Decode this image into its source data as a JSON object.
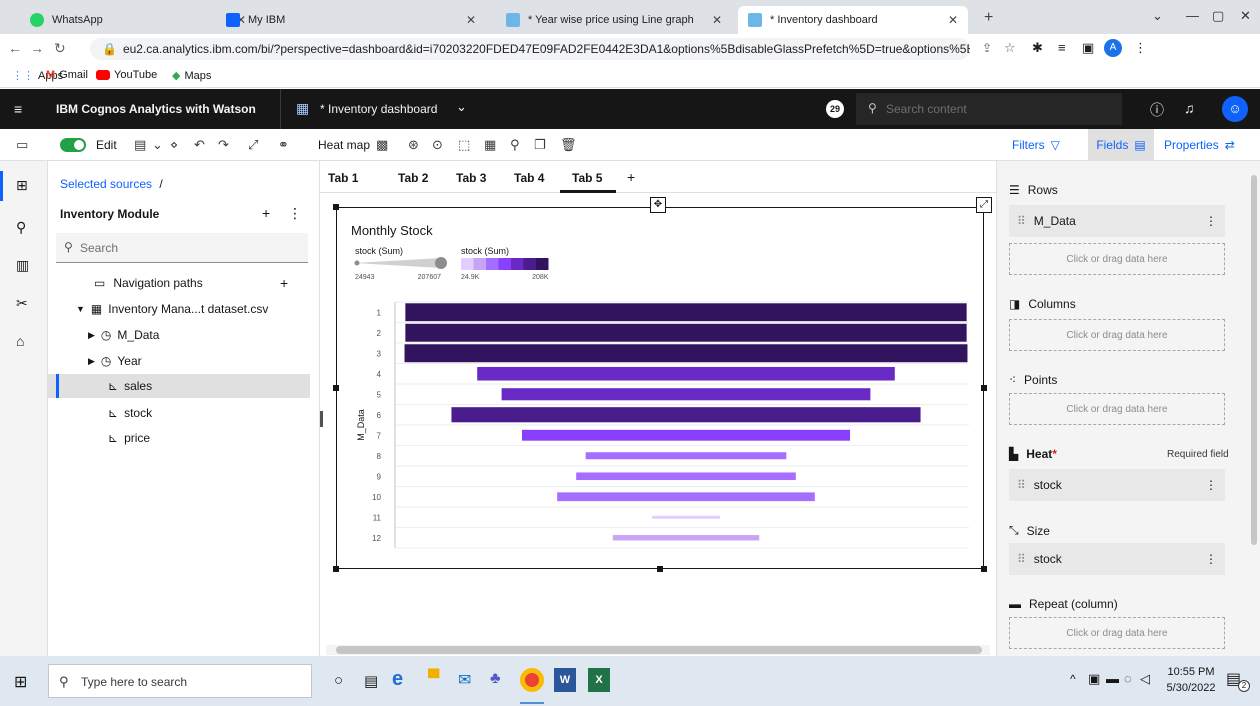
{
  "browser": {
    "tabs": [
      {
        "title": "WhatsApp",
        "favicon_color": "#25d366"
      },
      {
        "title": "My IBM",
        "favicon_color": "#0f62fe"
      },
      {
        "title": "* Year wise price using Line graph",
        "favicon_color": "#6cb6e8"
      },
      {
        "title": "* Inventory dashboard",
        "favicon_color": "#6cb6e8"
      }
    ],
    "new_tab": "+",
    "url": "eu2.ca.analytics.ibm.com/bi/?perspective=dashboard&id=i70203220FDED47E09FAD2FE0442E3DA1&options%5BdisableGlassPrefetch%5D=true&options%5Bcollections%5D%5BcanvasE...",
    "profile_initial": "A",
    "bookmarks": [
      {
        "label": "Apps",
        "color": "#4285f4"
      },
      {
        "label": "Gmail",
        "color": "#ea4335"
      },
      {
        "label": "YouTube",
        "color": "#ff0000"
      },
      {
        "label": "Maps",
        "color": "#34a853"
      }
    ]
  },
  "app": {
    "product": "IBM Cognos Analytics with Watson",
    "dashboard_title": "* Inventory dashboard",
    "notification_count": "29",
    "search_placeholder": "Search content"
  },
  "toolbar": {
    "edit_label": "Edit",
    "viz_type": "Heat map",
    "filters_label": "Filters",
    "fields_label": "Fields",
    "properties_label": "Properties"
  },
  "sources": {
    "breadcrumb": "Selected sources",
    "breadcrumb_sep": "/",
    "module": "Inventory Module",
    "search_placeholder": "Search",
    "items": [
      {
        "label": "Navigation paths",
        "icon": "folder-icon"
      },
      {
        "label": "Inventory Mana...t dataset.csv",
        "icon": "table-icon"
      },
      {
        "label": "M_Data",
        "icon": "clock-icon"
      },
      {
        "label": "Year",
        "icon": "clock-icon"
      },
      {
        "label": "sales",
        "icon": "measure-icon"
      },
      {
        "label": "stock",
        "icon": "measure-icon"
      },
      {
        "label": "price",
        "icon": "measure-icon"
      }
    ]
  },
  "canvas": {
    "tabs": [
      "Tab 1",
      "Tab 2",
      "Tab 3",
      "Tab 4",
      "Tab 5"
    ],
    "active_tab": 4,
    "add_tab": "+"
  },
  "chart_data": {
    "type": "bar",
    "title": "Monthly Stock",
    "ylabel": "M_Data",
    "legend": {
      "size_title": "stock (Sum)",
      "size_min": "24943",
      "size_max": "207607",
      "color_title": "stock (Sum)",
      "color_min": "24.9K",
      "color_max": "208K",
      "colors": [
        "#e3ccff",
        "#c8a4f5",
        "#a56eff",
        "#8a3ffc",
        "#6929c4",
        "#491d8b",
        "#31135e"
      ]
    },
    "categories": [
      "1",
      "2",
      "3",
      "4",
      "5",
      "6",
      "7",
      "8",
      "9",
      "10",
      "11",
      "12"
    ],
    "values": [
      207000,
      207000,
      207607,
      154000,
      136000,
      173000,
      121000,
      74000,
      81000,
      95000,
      24943,
      54000
    ],
    "xlim": [
      0,
      208000
    ]
  },
  "fields": {
    "rows_label": "Rows",
    "rows_item": "M_Data",
    "columns_label": "Columns",
    "points_label": "Points",
    "heat_label": "Heat",
    "heat_required_mark": "*",
    "heat_required_text": "Required field",
    "heat_item": "stock",
    "size_label": "Size",
    "size_item": "stock",
    "repeat_label": "Repeat (column)",
    "drop_hint": "Click or drag data here"
  },
  "taskbar": {
    "search_placeholder": "Type here to search",
    "time": "10:55 PM",
    "date": "5/30/2022",
    "notif_count": "2"
  }
}
